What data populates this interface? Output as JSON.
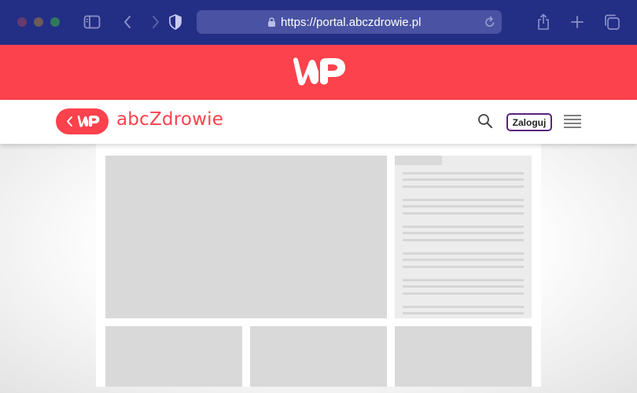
{
  "browser": {
    "url": "https://portal.abczdrowie.pl",
    "icons": [
      "sidebar-icon",
      "back-icon",
      "forward-icon",
      "shield-icon",
      "lock-icon",
      "reload-icon",
      "share-icon",
      "new-tab-icon",
      "tabs-icon"
    ]
  },
  "topbar": {
    "logo": "WP",
    "color": "#fc424c"
  },
  "header": {
    "back_logo": "WP",
    "brand": "abcZdrowie",
    "login_label": "Zaloguj",
    "brand_color": "#fc424c",
    "login_border_color": "#5a2380"
  },
  "content": {
    "state": "loading-skeleton"
  }
}
